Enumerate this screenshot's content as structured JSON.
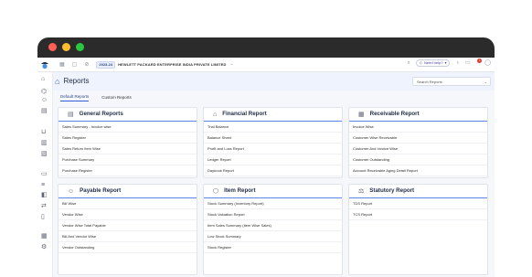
{
  "topbar": {
    "fy_badge": "2023-24",
    "company": "HEWLETT PACKARD ENTERPRISE INDIA PRIVATE LIMITED",
    "help_label": "Need help?",
    "notification_count": "1"
  },
  "header": {
    "title": "Reports",
    "search_label": "Search Reports"
  },
  "tabs": [
    "Default Reports",
    "Custom Reports"
  ],
  "cards": {
    "general": {
      "title": "General Reports",
      "items": [
        "Sales Summary - Invoice wise",
        "Sales Register",
        "Sales Return Item Wise",
        "Purchase Summary",
        "Purchase Register"
      ]
    },
    "financial": {
      "title": "Financial Report",
      "items": [
        "Trial Balance",
        "Balance Sheet",
        "Profit and Loss Report",
        "Ledger Report",
        "Daybook Report"
      ]
    },
    "receivable": {
      "title": "Receivable Report",
      "items": [
        "Invoice Wise",
        "Customer Wise Receivable",
        "Customer And Invoice Wise",
        "Customer Outstanding",
        "Account Receivable Aging Detail Report"
      ]
    },
    "payable": {
      "title": "Payable Report",
      "items": [
        "Bill Wise",
        "Vendor Wise",
        "Vendor Wise Total Payable",
        "Bill And Vendor Wise",
        "Vendor Outstanding"
      ]
    },
    "item": {
      "title": "Item Report",
      "items": [
        "Stock Summary (Inventory Report)",
        "Stock Valuation Report",
        "Item Sales Summary (Item Wise Sales)",
        "Low Stock Summary",
        "Stock Register"
      ]
    },
    "statutory": {
      "title": "Statutory Report",
      "items": [
        "TDS Report",
        "TCS Report"
      ]
    }
  },
  "colors": {
    "accent": "#3b5bdb",
    "titlebar_bg": "#eef3fd",
    "window_red": "#ff5f57",
    "window_yellow": "#febc2e",
    "window_green": "#28c840"
  }
}
